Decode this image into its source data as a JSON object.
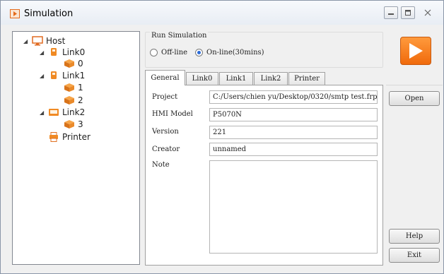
{
  "window": {
    "title": "Simulation"
  },
  "tree": {
    "host": "Host",
    "link0": "Link0",
    "link0_child": "0",
    "link1": "Link1",
    "link1_child1": "1",
    "link1_child2": "2",
    "link2": "Link2",
    "link2_child": "3",
    "printer": "Printer"
  },
  "run_simulation": {
    "label": "Run Simulation",
    "offline_label": "Off-line",
    "online_label": "On-line(30mins)",
    "selected": "On-line(30mins)"
  },
  "tabs": [
    {
      "label": "General",
      "active": true
    },
    {
      "label": "Link0"
    },
    {
      "label": "Link1"
    },
    {
      "label": "Link2"
    },
    {
      "label": "Printer"
    }
  ],
  "general": {
    "project_label": "Project",
    "project_value": "C:/Users/chien yu/Desktop/0320/smtp test.frp",
    "hmi_label": "HMI Model",
    "hmi_value": "P5070N",
    "version_label": "Version",
    "version_value": "221",
    "creator_label": "Creator",
    "creator_value": "unnamed",
    "note_label": "Note",
    "note_value": ""
  },
  "buttons": {
    "open": "Open",
    "help": "Help",
    "exit": "Exit"
  },
  "colors": {
    "run_button": "#f47a1f",
    "device_icon": "#f08a24",
    "selection_accent": "#2b6bd8"
  },
  "icons": [
    "app-icon",
    "host-icon",
    "device-icon",
    "box-icon",
    "printer-icon",
    "play-icon"
  ]
}
